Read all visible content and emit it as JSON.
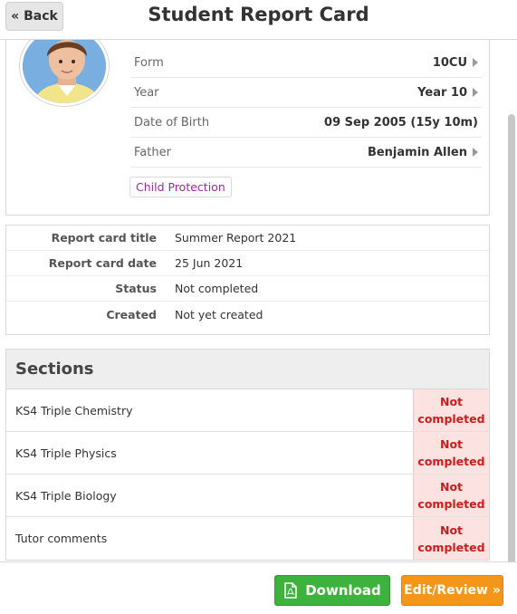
{
  "header": {
    "back_label": "« Back",
    "title": "Student Report Card"
  },
  "student": {
    "avatar_icon": "student-photo",
    "info": [
      {
        "label": "Form",
        "value": "10CU"
      },
      {
        "label": "Year",
        "value": "Year 10"
      },
      {
        "label": "Date of Birth",
        "value": "09 Sep 2005 (15y 10m)"
      },
      {
        "label": "Father",
        "value": "Benjamin Allen"
      }
    ],
    "badge": "Child Protection"
  },
  "details": [
    {
      "label": "Report card title",
      "value": "Summer Report 2021"
    },
    {
      "label": "Report card date",
      "value": "25 Jun 2021"
    },
    {
      "label": "Status",
      "value": "Not completed"
    },
    {
      "label": "Created",
      "value": "Not yet created"
    }
  ],
  "sections": {
    "heading": "Sections",
    "items": [
      {
        "name": "KS4 Triple Chemistry",
        "status": "Not completed"
      },
      {
        "name": "KS4 Triple Physics",
        "status": "Not completed"
      },
      {
        "name": "KS4 Triple Biology",
        "status": "Not completed"
      },
      {
        "name": "Tutor comments",
        "status": "Not completed"
      }
    ]
  },
  "footer": {
    "download_label": "Download",
    "download_icon": "pdf-icon",
    "edit_label": "Edit/Review »"
  },
  "colors": {
    "download": "#3db23d",
    "edit": "#f39619",
    "status_bg": "#fde2e2",
    "status_text": "#cc1d1d",
    "badge_text": "#9b2a9b"
  }
}
